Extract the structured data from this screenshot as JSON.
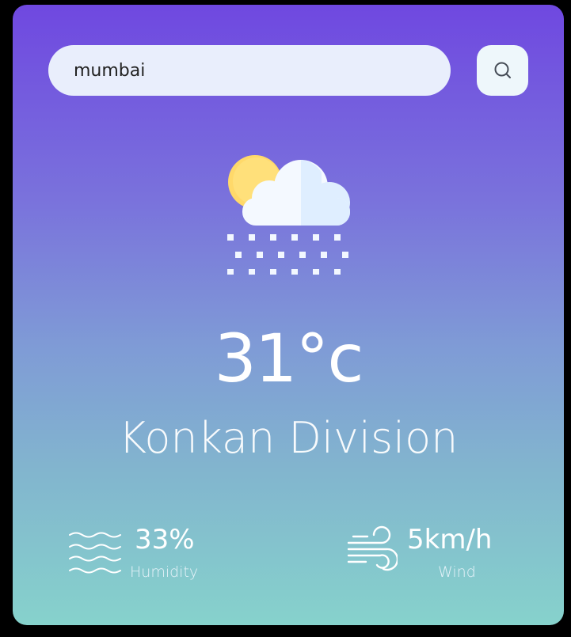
{
  "search": {
    "value": "mumbai",
    "button_icon": "search-icon"
  },
  "weather": {
    "icon": "partly-cloudy-snow-icon",
    "temperature": "31°c",
    "city": "Konkan Division"
  },
  "details": {
    "humidity": {
      "icon": "humidity-waves-icon",
      "value": "33%",
      "label": "Humidity"
    },
    "wind": {
      "icon": "wind-icon",
      "value": "5km/h",
      "label": "Wind"
    }
  },
  "colors": {
    "gradient_top": "#6f48e0",
    "gradient_bottom": "#86d2cc",
    "input_bg": "#e9eefc",
    "button_bg": "#eef7fb",
    "sun": "#ffe07a",
    "cloud": "#f4f9ff"
  }
}
